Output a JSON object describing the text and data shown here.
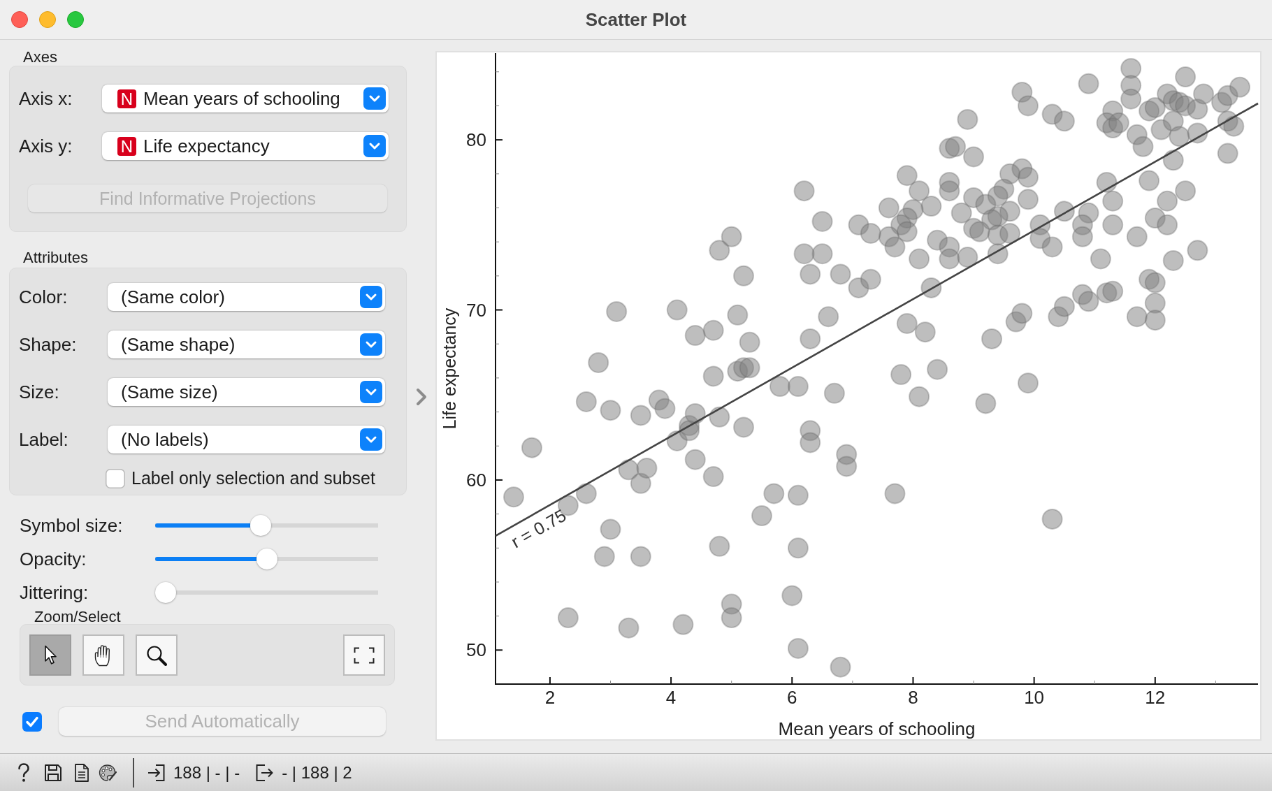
{
  "window": {
    "title": "Scatter Plot"
  },
  "axes": {
    "title": "Axes",
    "fields": [
      {
        "label": "Axis x:",
        "badge": "N",
        "value": "Mean years of schooling"
      },
      {
        "label": "Axis y:",
        "badge": "N",
        "value": "Life expectancy"
      }
    ],
    "find_button": {
      "label": "Find Informative Projections",
      "disabled": true
    }
  },
  "attributes": {
    "title": "Attributes",
    "fields": [
      {
        "label": "Color:",
        "value": "(Same color)"
      },
      {
        "label": "Shape:",
        "value": "(Same shape)"
      },
      {
        "label": "Size:",
        "value": "(Same size)"
      },
      {
        "label": "Label:",
        "value": "(No labels)"
      }
    ],
    "label_only_checkbox": {
      "label": "Label only selection and subset",
      "checked": false
    }
  },
  "sliders": [
    {
      "label": "Symbol size:",
      "level": 0.47
    },
    {
      "label": "Opacity:",
      "level": 0.5
    },
    {
      "label": "Jittering:",
      "level": 0
    }
  ],
  "zoom_select": {
    "title": "Zoom/Select",
    "tools": [
      {
        "kind": "select",
        "selected": true
      },
      {
        "kind": "pan",
        "selected": false
      },
      {
        "kind": "zoom",
        "selected": false
      }
    ]
  },
  "send": {
    "label": "Send Automatically",
    "checked": true,
    "disabled": true
  },
  "plot": {
    "chart_data": {
      "type": "scatter",
      "xlabel": "Mean years of schooling",
      "ylabel": "Life expectancy",
      "xlim": [
        1.1,
        13.7
      ],
      "ylim": [
        48,
        85.1
      ],
      "xticks": [
        2,
        4,
        6,
        8,
        10,
        12
      ],
      "yticks": [
        50,
        60,
        70,
        80
      ],
      "x": [
        1.4,
        1.7,
        2.3,
        2.3,
        2.6,
        2.6,
        2.8,
        3.0,
        3.0,
        2.9,
        3.1,
        3.3,
        3.3,
        3.5,
        3.5,
        3.6,
        3.5,
        3.8,
        3.9,
        4.1,
        4.1,
        4.2,
        4.3,
        4.3,
        4.4,
        4.4,
        4.4,
        4.7,
        4.7,
        4.7,
        4.8,
        4.8,
        4.8,
        5.0,
        5.0,
        5.0,
        5.1,
        5.1,
        5.2,
        5.2,
        5.2,
        5.3,
        5.3,
        5.5,
        5.7,
        5.8,
        6.0,
        6.1,
        6.1,
        6.1,
        6.1,
        6.2,
        6.2,
        6.3,
        6.3,
        6.3,
        6.3,
        6.5,
        6.5,
        6.6,
        6.7,
        6.8,
        6.8,
        6.9,
        6.9,
        7.7,
        10.3,
        11.6,
        11.6,
        11.6,
        12.5,
        10.9,
        9.8,
        9.9,
        10.3,
        10.5,
        8.9,
        8.6,
        8.7,
        9.0,
        11.3,
        11.2,
        11.3,
        11.4,
        11.7,
        11.8,
        11.9,
        12.0,
        12.2,
        12.3,
        12.4,
        12.5,
        12.7,
        12.8,
        13.1,
        13.2,
        13.4,
        13.2,
        13.3,
        13.2,
        12.1,
        12.3,
        12.4,
        12.7,
        12.3,
        11.9,
        11.2,
        11.3,
        12.2,
        12.5,
        12.0,
        12.2,
        11.3,
        11.7,
        10.9,
        10.8,
        10.8,
        10.5,
        10.1,
        10.1,
        10.3,
        11.1,
        12.3,
        12.7,
        9.9,
        9.8,
        9.9,
        9.6,
        9.5,
        9.4,
        9.0,
        9.2,
        9.6,
        9.4,
        9.3,
        8.8,
        9.0,
        9.1,
        9.4,
        9.6,
        9.4,
        8.6,
        8.6,
        8.3,
        8.1,
        7.9,
        8.0,
        7.6,
        7.9,
        7.8,
        7.9,
        7.6,
        7.7,
        7.1,
        7.3,
        8.4,
        8.6,
        8.6,
        8.9,
        8.1,
        7.1,
        7.3,
        8.3,
        7.9,
        8.2,
        9.3,
        9.7,
        9.8,
        10.4,
        10.5,
        10.8,
        10.9,
        11.2,
        11.3,
        11.9,
        12.0,
        12.0,
        12.0,
        11.7,
        7.8,
        8.4,
        8.1,
        9.2,
        9.9
      ],
      "values": [
        59.0,
        61.9,
        51.9,
        58.5,
        59.2,
        64.6,
        66.9,
        57.1,
        64.1,
        55.5,
        69.9,
        51.3,
        60.6,
        55.5,
        59.8,
        60.7,
        63.8,
        64.7,
        64.2,
        70.0,
        62.3,
        51.5,
        63.2,
        62.9,
        63.9,
        61.2,
        68.5,
        68.8,
        60.2,
        66.1,
        73.5,
        56.1,
        63.7,
        74.3,
        52.7,
        51.9,
        69.7,
        66.4,
        72.0,
        63.1,
        66.6,
        68.1,
        66.6,
        57.9,
        59.2,
        65.5,
        53.2,
        50.1,
        59.1,
        56.0,
        65.5,
        77.0,
        73.3,
        72.1,
        68.3,
        62.9,
        62.2,
        75.2,
        73.3,
        69.6,
        65.1,
        49.0,
        72.1,
        61.5,
        60.8,
        59.2,
        57.7,
        84.2,
        83.2,
        82.4,
        83.7,
        83.3,
        82.8,
        82.0,
        81.5,
        81.1,
        81.2,
        79.5,
        79.6,
        79.0,
        81.7,
        81.0,
        80.7,
        81.0,
        80.3,
        79.6,
        81.7,
        81.9,
        82.7,
        82.3,
        82.2,
        82.0,
        81.8,
        82.7,
        82.2,
        82.6,
        83.1,
        81.1,
        80.8,
        79.2,
        80.6,
        81.1,
        80.2,
        80.4,
        78.8,
        77.6,
        77.5,
        76.4,
        76.4,
        77.0,
        75.4,
        75.0,
        75.0,
        74.3,
        75.7,
        75.0,
        74.3,
        75.8,
        75.0,
        74.2,
        73.7,
        73.0,
        72.9,
        73.5,
        76.5,
        78.3,
        77.8,
        78.0,
        77.1,
        76.7,
        76.6,
        76.2,
        75.8,
        75.5,
        75.3,
        75.7,
        74.8,
        74.6,
        74.4,
        74.5,
        73.3,
        77.5,
        77.0,
        76.1,
        77.0,
        77.9,
        75.9,
        76.0,
        75.4,
        75.0,
        74.6,
        74.3,
        73.7,
        75.0,
        74.5,
        74.1,
        73.7,
        73.0,
        73.1,
        73.0,
        71.3,
        71.8,
        71.3,
        69.2,
        68.7,
        68.3,
        69.3,
        69.8,
        69.6,
        70.2,
        70.9,
        70.5,
        71.0,
        71.1,
        71.8,
        71.6,
        70.4,
        69.4,
        69.6,
        66.2,
        66.5,
        64.9,
        64.5,
        65.7
      ],
      "annotations": [
        "r = 0.75"
      ]
    }
  },
  "status_bar": {
    "input_summary": "188 | - | -",
    "output_summary": "- | 188 | 2"
  }
}
